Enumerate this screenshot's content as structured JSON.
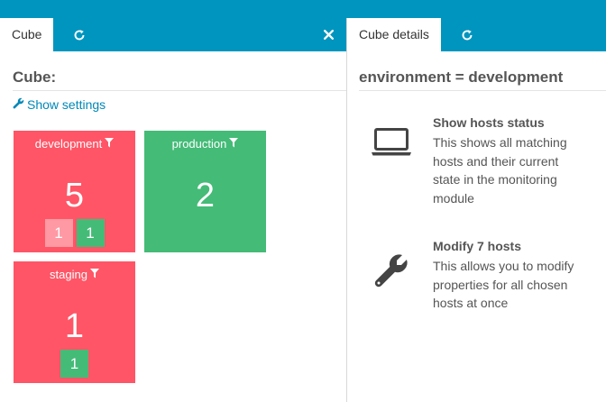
{
  "left_tabs": {
    "active_label": "Cube"
  },
  "cube_panel": {
    "title": "Cube:",
    "show_settings_label": "Show settings",
    "cubes": [
      {
        "label": "development",
        "count": "5",
        "badges": [
          "1",
          "1"
        ]
      },
      {
        "label": "production",
        "count": "2",
        "badges": []
      },
      {
        "label": "staging",
        "count": "1",
        "badges": [
          "1"
        ]
      }
    ]
  },
  "right_tabs": {
    "active_label": "Cube details"
  },
  "details_panel": {
    "title": "environment = development",
    "actions": [
      {
        "title": "Show hosts status",
        "description": "This shows all matching hosts and their current state in the monitoring module",
        "icon": "laptop-icon"
      },
      {
        "title": "Modify 7 hosts",
        "description": "This allows you to modify properties for all chosen hosts at once",
        "icon": "wrench-icon"
      }
    ]
  },
  "colors": {
    "topbar": "#0095bf",
    "critical": "#ff5566",
    "critical_handled": "#ff99a3",
    "ok": "#44bb77",
    "link": "#0088b8"
  }
}
